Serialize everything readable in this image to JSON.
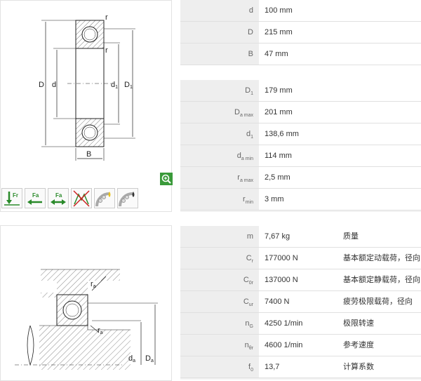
{
  "drawing_top": {
    "labels": {
      "r1": "r",
      "r2": "r",
      "D": "D",
      "d": "d",
      "d1": "d",
      "d1_sub": "1",
      "D1": "D",
      "D1_sub": "1",
      "B": "B"
    }
  },
  "drawing_bottom": {
    "labels": {
      "ra1": "r",
      "ra1_sub": "a",
      "ra2": "r",
      "ra2_sub": "a",
      "da": "d",
      "da_sub": "a",
      "Da": "D",
      "Da_sub": "a"
    }
  },
  "zoom_icon": "magnifier-zoom-icon",
  "load_icons": [
    {
      "name": "radial-load-icon",
      "label": "Fr"
    },
    {
      "name": "axial-load-left-icon",
      "label": "Fa"
    },
    {
      "name": "axial-load-both-icon",
      "label": "Fa"
    },
    {
      "name": "not-suitable-icon",
      "label": ""
    },
    {
      "name": "grease-lubrication-icon",
      "label": ""
    },
    {
      "name": "oil-lubrication-icon",
      "label": ""
    }
  ],
  "dimensions_a": [
    {
      "key": "d",
      "sub": "",
      "value": "100  mm"
    },
    {
      "key": "D",
      "sub": "",
      "value": "215  mm"
    },
    {
      "key": "B",
      "sub": "",
      "value": "47  mm"
    }
  ],
  "dimensions_b": [
    {
      "key": "D",
      "sub": "1",
      "value": "179  mm"
    },
    {
      "key": "D",
      "sub": "a max",
      "value": "201  mm"
    },
    {
      "key": "d",
      "sub": "1",
      "value": "138,6  mm"
    },
    {
      "key": "d",
      "sub": "a min",
      "value": "114  mm"
    },
    {
      "key": "r",
      "sub": "a max",
      "value": "2,5  mm"
    },
    {
      "key": "r",
      "sub": "min",
      "value": "3  mm"
    }
  ],
  "properties": [
    {
      "key": "m",
      "sub": "",
      "value": "7,67  kg",
      "desc": "质量"
    },
    {
      "key": "C",
      "sub": "r",
      "value": "177000  N",
      "desc": "基本额定动载荷，径向"
    },
    {
      "key": "C",
      "sub": "0r",
      "value": "137000  N",
      "desc": "基本额定静载荷，径向"
    },
    {
      "key": "C",
      "sub": "ur",
      "value": "7400  N",
      "desc": "疲劳极限载荷，径向"
    },
    {
      "key": "n",
      "sub": "G",
      "value": "4250  1/min",
      "desc": "极限转速"
    },
    {
      "key": "n",
      "sub": "θr",
      "value": "4600  1/min",
      "desc": "参考速度"
    },
    {
      "key": "f",
      "sub": "0",
      "value": "13,7",
      "desc": "计算系数"
    }
  ]
}
